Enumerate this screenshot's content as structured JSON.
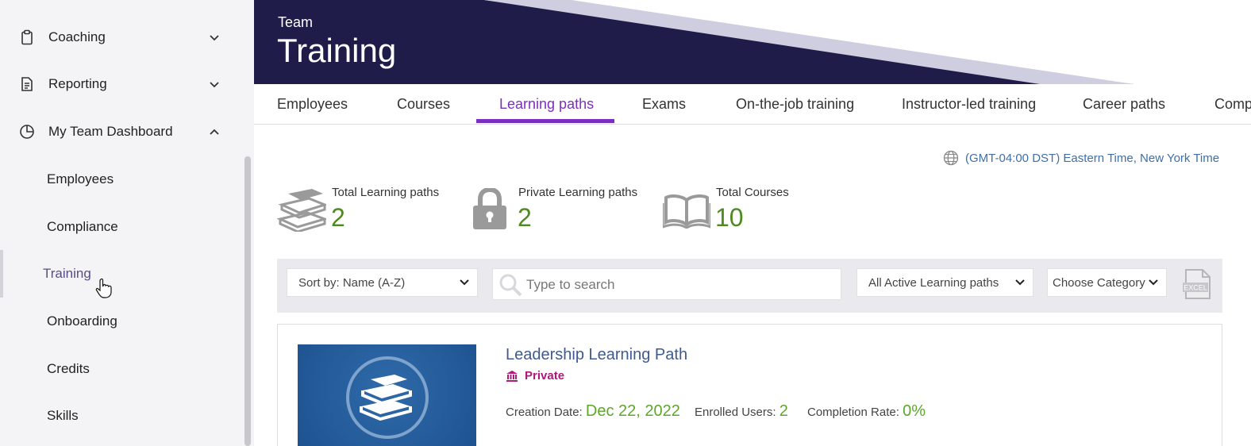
{
  "sidebar": {
    "items": [
      {
        "label": "Coaching",
        "icon": "clipboard-icon",
        "expanded": false
      },
      {
        "label": "Reporting",
        "icon": "document-icon",
        "expanded": false
      },
      {
        "label": "My Team Dashboard",
        "icon": "pie-chart-icon",
        "expanded": true
      }
    ],
    "subitems": [
      {
        "label": "Employees",
        "active": false
      },
      {
        "label": "Compliance",
        "active": false
      },
      {
        "label": "Training",
        "active": true
      },
      {
        "label": "Onboarding",
        "active": false
      },
      {
        "label": "Credits",
        "active": false
      },
      {
        "label": "Skills",
        "active": false
      }
    ]
  },
  "header": {
    "subtitle": "Team",
    "title": "Training"
  },
  "tabs": [
    {
      "label": "Employees",
      "active": false
    },
    {
      "label": "Courses",
      "active": false
    },
    {
      "label": "Learning paths",
      "active": true
    },
    {
      "label": "Exams",
      "active": false
    },
    {
      "label": "On-the-job training",
      "active": false
    },
    {
      "label": "Instructor-led training",
      "active": false
    },
    {
      "label": "Career paths",
      "active": false
    },
    {
      "label": "Comp",
      "active": false
    }
  ],
  "timezone": "(GMT-04:00 DST) Eastern Time, New York Time",
  "stats": [
    {
      "label": "Total Learning paths",
      "value": "2",
      "icon": "books-icon"
    },
    {
      "label": "Private Learning paths",
      "value": "2",
      "icon": "lock-icon"
    },
    {
      "label": "Total Courses",
      "value": "10",
      "icon": "open-book-icon"
    }
  ],
  "filters": {
    "sort": "Sort by: Name (A-Z)",
    "search_placeholder": "Type to search",
    "status": "All Active Learning paths",
    "category": "Choose Category",
    "export_label": "EXCEL"
  },
  "card": {
    "title": "Leadership Learning Path",
    "visibility": "Private",
    "creation_label": "Creation Date:",
    "creation_value": "Dec 22, 2022",
    "enrolled_label": "Enrolled Users:",
    "enrolled_value": "2",
    "completion_label": "Completion Rate:",
    "completion_value": "0%"
  },
  "colors": {
    "header_bg": "#201c4a",
    "accent": "#7b2fbe",
    "stat_value": "#4e8a20",
    "link": "#3f6fa6",
    "private": "#b0187a"
  }
}
